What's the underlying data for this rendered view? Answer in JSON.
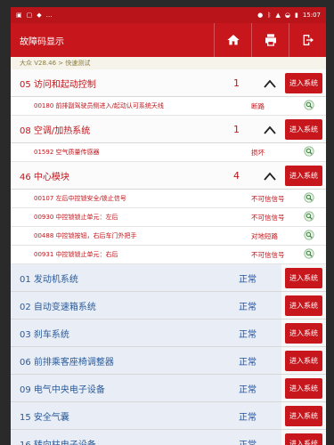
{
  "statusbar": {
    "time": "15:07",
    "left_icons": [
      "image-icon",
      "tablet-icon",
      "chat-icon",
      "dots-icon"
    ],
    "right_icons": [
      "location-icon",
      "bluetooth-icon",
      "signal-icon",
      "wifi-icon",
      "battery-icon"
    ]
  },
  "header": {
    "title": "故障码显示"
  },
  "breadcrumb": "大众 V28.46 > 快速测试",
  "systems": [
    {
      "name": "05 访问和起动控制",
      "count": "1",
      "status": "",
      "button": "进入系统",
      "fault": true,
      "dtcs": [
        {
          "text": "00180 前排副驾驶员侧进入/起动认可系统天线",
          "state": "断路"
        }
      ]
    },
    {
      "name": "08 空调/加热系统",
      "count": "1",
      "status": "",
      "button": "进入系统",
      "fault": true,
      "dtcs": [
        {
          "text": "01592 空气质量传感器",
          "state": "损坏"
        }
      ]
    },
    {
      "name": "46 中心模块",
      "count": "4",
      "status": "",
      "button": "进入系统",
      "fault": true,
      "dtcs": [
        {
          "text": "00107 左后中控锁安全/锁止信号",
          "state": "不可信信号"
        },
        {
          "text": "00930 中控锁锁止单元：左后",
          "state": "不可信信号"
        },
        {
          "text": "00488 中控锁按钮，右后车门外把手",
          "state": "对地短路"
        },
        {
          "text": "00931 中控锁锁止单元：右后",
          "state": "不可信信号"
        }
      ]
    },
    {
      "name": "01 发动机系统",
      "count": "",
      "status": "正常",
      "button": "进入系统",
      "fault": false,
      "dtcs": []
    },
    {
      "name": "02 自动变速箱系统",
      "count": "",
      "status": "正常",
      "button": "进入系统",
      "fault": false,
      "dtcs": []
    },
    {
      "name": "03 刹车系统",
      "count": "",
      "status": "正常",
      "button": "进入系统",
      "fault": false,
      "dtcs": []
    },
    {
      "name": "06 前排乘客座椅调整器",
      "count": "",
      "status": "正常",
      "button": "进入系统",
      "fault": false,
      "dtcs": []
    },
    {
      "name": "09 电气中央电子设备",
      "count": "",
      "status": "正常",
      "button": "进入系统",
      "fault": false,
      "dtcs": []
    },
    {
      "name": "15 安全气囊",
      "count": "",
      "status": "正常",
      "button": "进入系统",
      "fault": false,
      "dtcs": []
    },
    {
      "name": "16 转向柱电子设备",
      "count": "",
      "status": "正常",
      "button": "进入系统",
      "fault": false,
      "dtcs": []
    }
  ],
  "colors": {
    "brand_red": "#c8161d",
    "fault_text": "#c0151b",
    "ok_text": "#1f4fa0"
  }
}
